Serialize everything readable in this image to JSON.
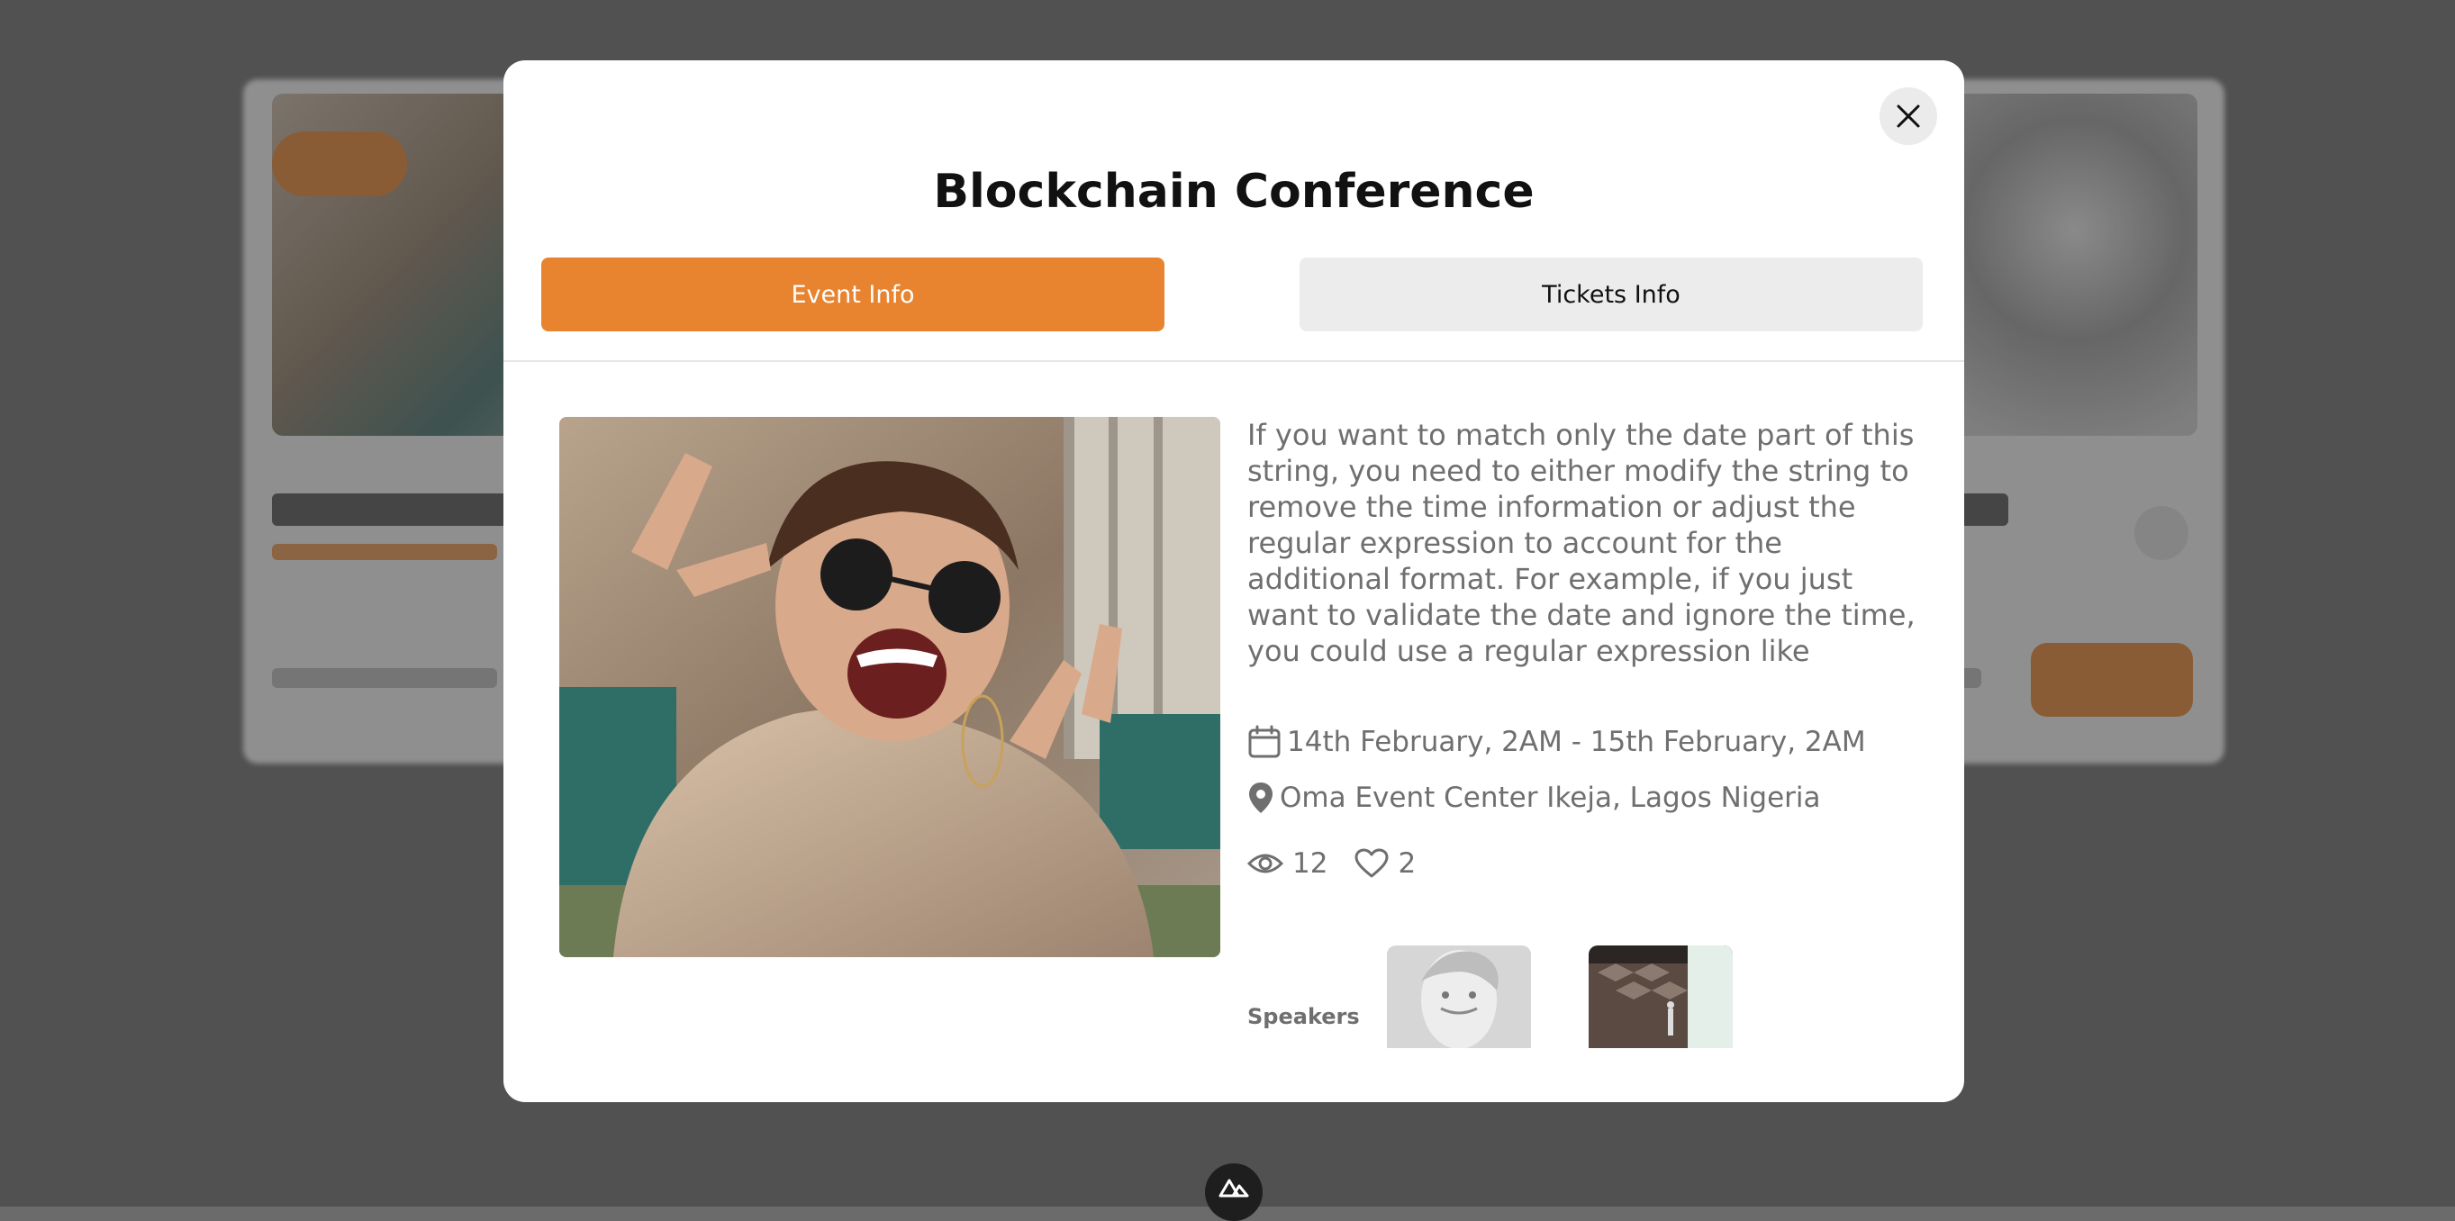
{
  "modal": {
    "title": "Blockchain Conference",
    "tabs": [
      {
        "label": "Event Info",
        "active": true
      },
      {
        "label": "Tickets Info",
        "active": false
      }
    ],
    "description": "If you want to match only the date part of this string, you need to either modify the string to remove the time information or adjust the regular expression to account for the additional format. For example, if you just want to validate the date and ignore the time, you could use a regular expression like",
    "date": "14th February, 2AM - 15th February, 2AM",
    "location": "Oma Event Center Ikeja, Lagos Nigeria",
    "views": "12",
    "likes": "2",
    "speakers_label": "Speakers"
  },
  "colors": {
    "accent": "#e8832f",
    "tab_inactive_bg": "#ececec",
    "text_muted": "#6f6f6f"
  },
  "icons": [
    "close-icon",
    "calendar-icon",
    "location-pin-icon",
    "eye-icon",
    "heart-icon",
    "nuxt-logo-icon"
  ]
}
